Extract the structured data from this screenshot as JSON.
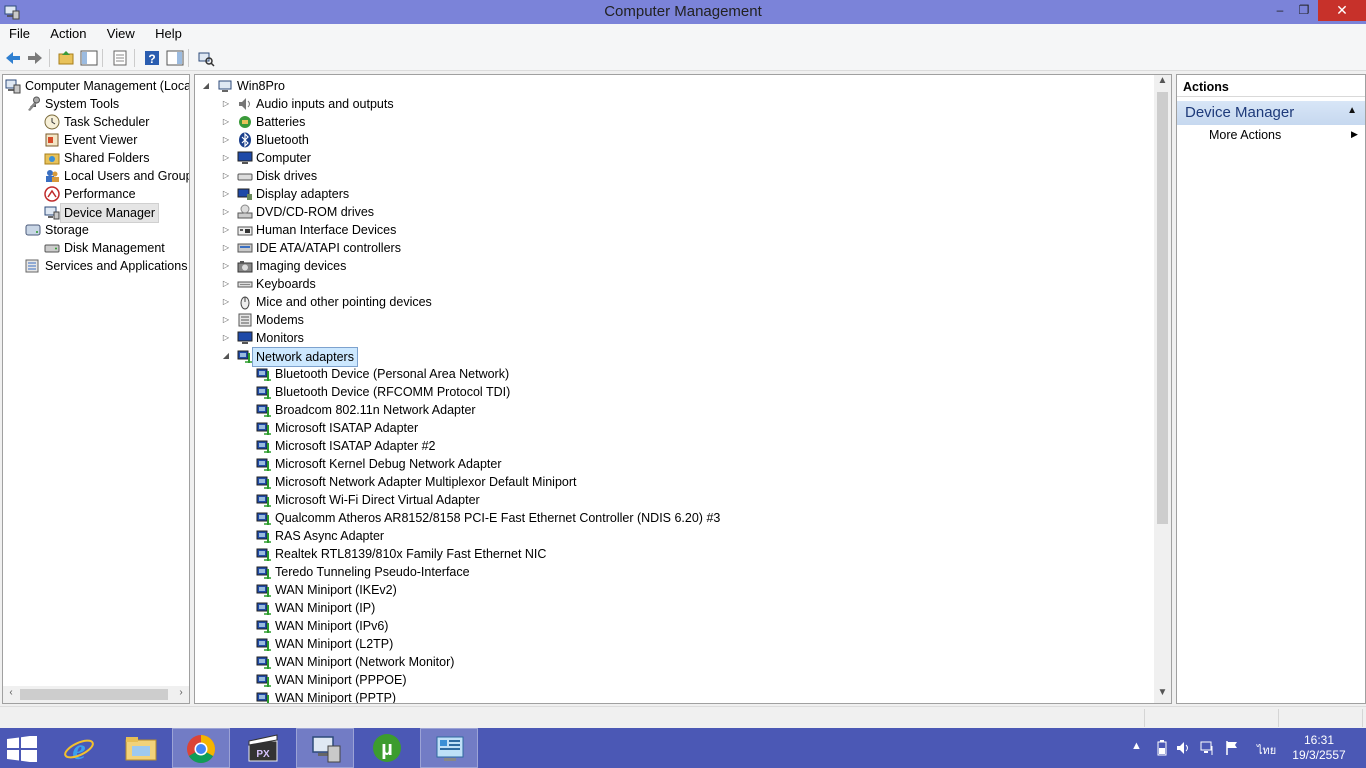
{
  "window": {
    "title": "Computer Management"
  },
  "title_buttons": {
    "minimize": "–",
    "maximize": "❐",
    "close": "✕"
  },
  "menu": [
    "File",
    "Action",
    "View",
    "Help"
  ],
  "left_tree": [
    {
      "label": "Computer Management (Local",
      "icon": "computer-management-icon",
      "expander": "none"
    },
    {
      "label": "System Tools",
      "icon": "tools-icon",
      "expander": "expanded"
    },
    {
      "label": "Task Scheduler",
      "icon": "clock-icon",
      "expander": "collapsed"
    },
    {
      "label": "Event Viewer",
      "icon": "event-viewer-icon",
      "expander": "collapsed"
    },
    {
      "label": "Shared Folders",
      "icon": "shared-folder-icon",
      "expander": "collapsed"
    },
    {
      "label": "Local Users and Groups",
      "icon": "users-icon",
      "expander": "collapsed"
    },
    {
      "label": "Performance",
      "icon": "performance-icon",
      "expander": "collapsed"
    },
    {
      "label": "Device Manager",
      "icon": "device-manager-icon",
      "expander": "none",
      "selected": true
    },
    {
      "label": "Storage",
      "icon": "storage-icon",
      "expander": "expanded"
    },
    {
      "label": "Disk Management",
      "icon": "disk-icon",
      "expander": "none"
    },
    {
      "label": "Services and Applications",
      "icon": "services-icon",
      "expander": "collapsed"
    }
  ],
  "device_tree": {
    "root": "Win8Pro",
    "categories": [
      "Audio inputs and outputs",
      "Batteries",
      "Bluetooth",
      "Computer",
      "Disk drives",
      "Display adapters",
      "DVD/CD-ROM drives",
      "Human Interface Devices",
      "IDE ATA/ATAPI controllers",
      "Imaging devices",
      "Keyboards",
      "Mice and other pointing devices",
      "Modems",
      "Monitors",
      "Network adapters"
    ],
    "expanded_category": "Network adapters",
    "network_adapters": [
      "Bluetooth Device (Personal Area Network)",
      "Bluetooth Device (RFCOMM Protocol TDI)",
      "Broadcom 802.11n Network Adapter",
      "Microsoft ISATAP Adapter",
      "Microsoft ISATAP Adapter #2",
      "Microsoft Kernel Debug Network Adapter",
      "Microsoft Network Adapter Multiplexor Default Miniport",
      "Microsoft Wi-Fi Direct Virtual Adapter",
      "Qualcomm Atheros AR8152/8158 PCI-E Fast Ethernet Controller (NDIS 6.20) #3",
      "RAS Async Adapter",
      "Realtek RTL8139/810x Family Fast Ethernet NIC",
      "Teredo Tunneling Pseudo-Interface",
      "WAN Miniport (IKEv2)",
      "WAN Miniport (IP)",
      "WAN Miniport (IPv6)",
      "WAN Miniport (L2TP)",
      "WAN Miniport (Network Monitor)",
      "WAN Miniport (PPPOE)",
      "WAN Miniport (PPTP)"
    ]
  },
  "actions": {
    "header": "Actions",
    "section": "Device Manager",
    "items": [
      "More Actions"
    ]
  },
  "taskbar": {
    "apps": [
      "start-icon",
      "internet-explorer-icon",
      "file-explorer-icon",
      "chrome-icon",
      "media-player-icon",
      "computer-management-icon",
      "utorrent-icon",
      "control-panel-icon"
    ],
    "language": "ไทย",
    "time": "16:31",
    "date": "19/3/2557"
  },
  "colors": {
    "titlebar": "#7b83d9",
    "taskbar": "#4b58b5",
    "close_button": "#c7312a",
    "selection_blue": "#cce8ff",
    "actions_section": "#c6d8ef"
  }
}
